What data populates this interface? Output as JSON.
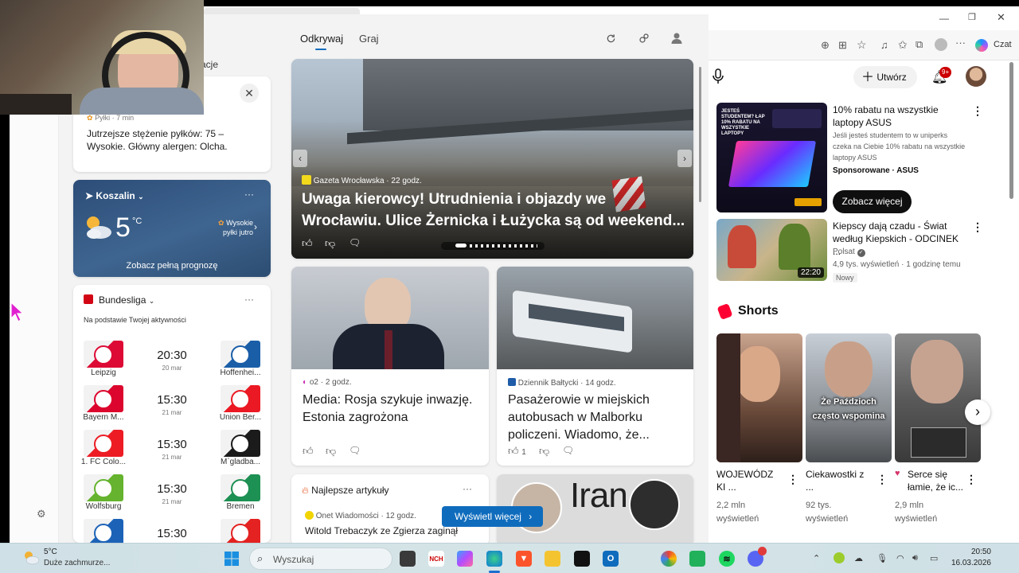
{
  "msn": {
    "tabs": [
      "Odkrywaj",
      "Graj"
    ],
    "partial_label": "acje",
    "pollen": {
      "source": "Pyłki · 7 min",
      "text": "Jutrzejsze stężenie pyłków: 75 – Wysokie. Główny alergen: Olcha."
    },
    "weather": {
      "city": "Koszalin",
      "temp": "5",
      "unit": "°C",
      "alert": "Wysokie pyłki jutro",
      "cta": "Zobacz pełną prognozę"
    },
    "sports": {
      "league": "Bundesliga",
      "subtitle": "Na podstawie Twojej aktywności",
      "matches": [
        {
          "home": "Leipzig",
          "away": "Hoffenhei...",
          "time": "20:30",
          "date": "20 mar",
          "home_color": "#dd0a35",
          "away_color": "#1a5ea8"
        },
        {
          "home": "Bayern M...",
          "away": "Union Ber...",
          "time": "15:30",
          "date": "21 mar",
          "home_color": "#dc052d",
          "away_color": "#eb1923"
        },
        {
          "home": "1. FC Colo...",
          "away": "M`gladba...",
          "time": "15:30",
          "date": "21 mar",
          "home_color": "#ed1c24",
          "away_color": "#1b1b1b"
        },
        {
          "home": "Wolfsburg",
          "away": "Bremen",
          "time": "15:30",
          "date": "21 mar",
          "home_color": "#65b32e",
          "away_color": "#1d9053"
        },
        {
          "home": "",
          "away": "",
          "time": "15:30",
          "date": "",
          "home_color": "#1c63b7",
          "away_color": "#e32221"
        }
      ]
    },
    "hero": {
      "source": "Gazeta Wrocławska",
      "age": "22 godz.",
      "title": "Uwaga kierowcy! Utrudnienia i objazdy we Wrocławiu. Ulice Żernicka i Łużycka są od weekend..."
    },
    "news1": {
      "source": "o2",
      "age": "2 godz.",
      "title": "Media: Rosja szykuje inwazję. Estonia zagrożona"
    },
    "news2": {
      "source": "Dziennik Bałtycki",
      "age": "14 godz.",
      "title": "Pasażerowie w miejskich autobusach w Malborku policzeni. Wiadomo, że...",
      "likes": "1"
    },
    "top": {
      "title": "Najlepsze artykuły",
      "source": "Onet Wiadomości",
      "age": "12 godz.",
      "headline": "Witold Trebaczyk ze Zgierza zaginął"
    },
    "iran_text": "Iran",
    "show_more": "Wyświetl więcej"
  },
  "yt": {
    "browser_right": "Czat",
    "create": "Utwórz",
    "notif": "9+",
    "ad": {
      "title": "10% rabatu na wszystkie laptopy ASUS",
      "desc": "Jeśli jesteś studentem to w uniperks czeka na Ciebie 10% rabatu na wszystkie laptopy ASUS",
      "sponsor": "Sponsorowane · ASUS",
      "cta": "Zobacz więcej",
      "thumb_text": "JESTEŚ STUDENTEM? ŁAP 10% RABATU NA WSZYSTKIE LAPTOPY"
    },
    "video": {
      "title": "Kiepscy dają czadu - Świat według Kiepskich - ODCINEK ...",
      "channel": "Polsat",
      "meta": "4,9 tys. wyświetleń · 1 godzinę temu",
      "badge": "Nowy",
      "duration": "22:20"
    },
    "shorts_title": "Shorts",
    "shorts": [
      {
        "title": "WOJEWÓDZ KI ...",
        "views": "2,2 mln wyświetleń",
        "overlay": ""
      },
      {
        "title": "Ciekawostki z ...",
        "views": "92 tys. wyświetleń",
        "overlay": "Że Paździoch często wspomina"
      },
      {
        "title": "Serce się łamie, że ic...",
        "views": "2,9 mln wyświetleń",
        "overlay": ""
      }
    ]
  },
  "taskbar": {
    "temp": "5°C",
    "weather": "Duże zachmurze...",
    "search": "Wyszukaj",
    "time": "20:50",
    "date": "16.03.2026",
    "nch": "NCH"
  }
}
